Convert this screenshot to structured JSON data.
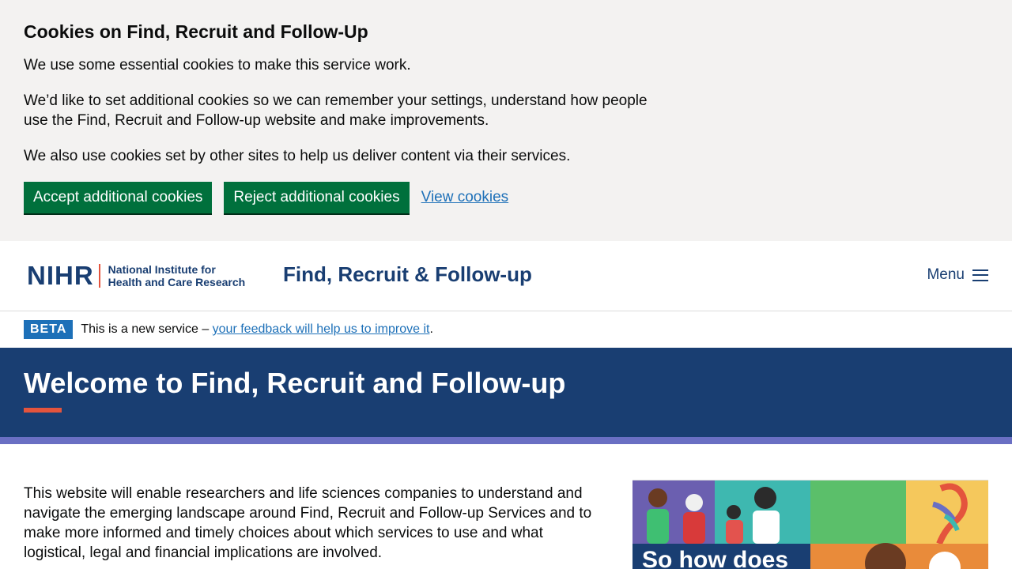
{
  "cookie_banner": {
    "title": "Cookies on Find, Recruit and Follow-Up",
    "paragraphs": [
      "We use some essential cookies to make this service work.",
      "We’d like to set additional cookies so we can remember your settings, understand how people use the Find, Recruit and Follow-up website and make improvements.",
      "We also use cookies set by other sites to help us deliver content via their services."
    ],
    "accept_label": "Accept additional cookies",
    "reject_label": "Reject additional cookies",
    "view_label": "View cookies"
  },
  "header": {
    "logo_acronym": "NIHR",
    "logo_line1": "National Institute for",
    "logo_line2": "Health and Care Research",
    "service_name": "Find, Recruit & Follow-up",
    "menu_label": "Menu"
  },
  "phase_banner": {
    "tag": "BETA",
    "text_before": "This is a new service – ",
    "link_text": "your feedback will help us to improve it",
    "text_after": "."
  },
  "hero": {
    "title": "Welcome to Find, Recruit and Follow-up"
  },
  "main": {
    "intro": "This website will enable researchers and life sciences companies to understand and navigate the emerging landscape around Find, Recruit and Follow-up Services and to make more informed and timely choices about which services to use and what logistical, legal and financial implications are involved."
  },
  "illustration": {
    "caption_text": "So how does"
  },
  "colors": {
    "brand_navy": "#193e72",
    "accent_red": "#e4543d",
    "button_green": "#00703c",
    "link_blue": "#1d70b8",
    "strip_purple": "#6a6fc3"
  }
}
